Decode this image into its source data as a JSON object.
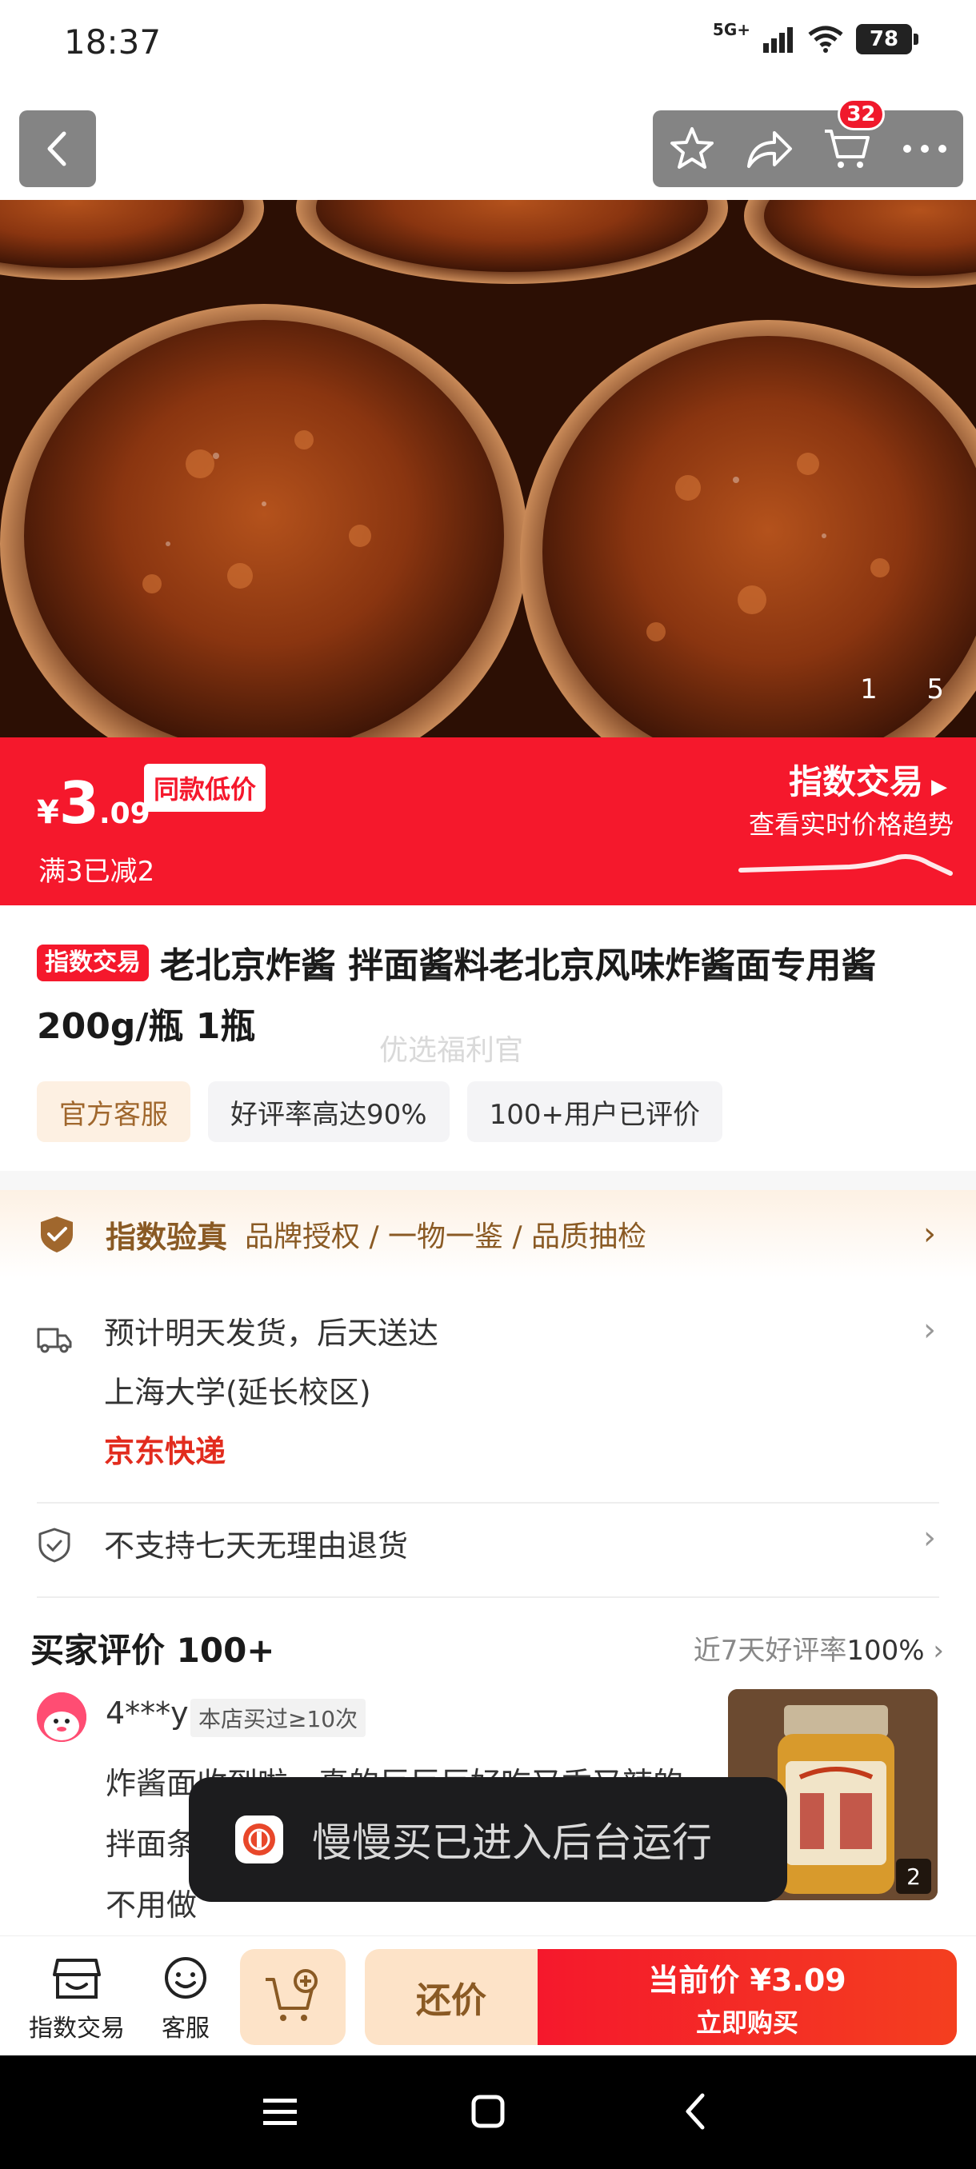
{
  "status_bar": {
    "time": "18:37",
    "network": "5G+",
    "battery": "78"
  },
  "top_bar": {
    "cart_count": "32"
  },
  "gallery": {
    "current": "1",
    "total": "5"
  },
  "price_banner": {
    "currency": "¥",
    "price_int": "3",
    "price_dec": ".09",
    "same_low_label": "同款低价",
    "promo": "满3已减2",
    "index_trade_label": "指数交易",
    "price_trend_label": "查看实时价格趋势"
  },
  "product": {
    "tag": "指数交易",
    "title": "老北京炸酱 拌面酱料老北京风味炸酱面专用酱200g/瓶 1瓶",
    "watermark": "优选福利官",
    "chips": [
      "官方客服",
      "好评率高达90%",
      "100+用户已评价"
    ]
  },
  "verify": {
    "title": "指数验真",
    "items": "品牌授权 / 一物一鉴 / 品质抽检"
  },
  "delivery": {
    "eta": "预计明天发货，后天送达",
    "address": "上海大学(延长校区)",
    "carrier": "京东快递"
  },
  "return_policy": "不支持七天无理由退货",
  "reviews": {
    "title": "买家评价 100+",
    "rate_label": "近7天好评率",
    "rate_value": "100%",
    "item": {
      "user": "4***y",
      "badge": "本店买过≥10次",
      "text": "炸酱面收到啦，真的巨巨巨好吃又香又辣的\n拌面条\n不用做",
      "photo_count": "2"
    }
  },
  "toast": {
    "text": "慢慢买已进入后台运行"
  },
  "bottom_bar": {
    "index_trade": "指数交易",
    "service": "客服",
    "bargain": "还价",
    "buy_line1": "当前价 ¥3.09",
    "buy_line2": "立即购买"
  },
  "colors": {
    "accent_red": "#f5182c",
    "gold": "#8a5a24",
    "peach": "#fde3c8"
  }
}
